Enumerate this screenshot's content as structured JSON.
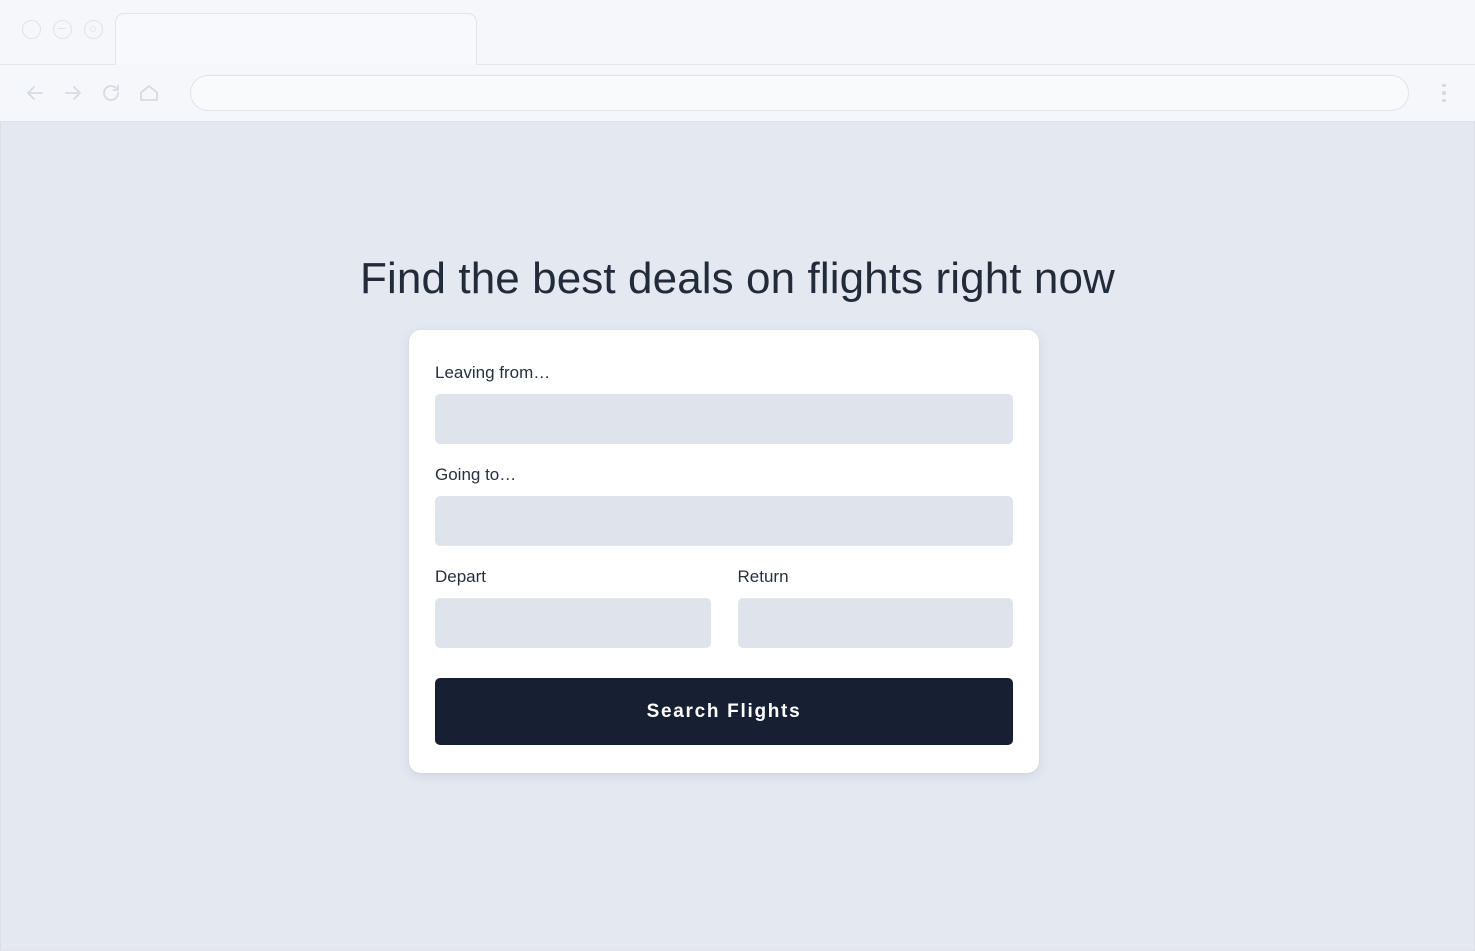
{
  "browser": {
    "window_controls": [
      {
        "name": "close",
        "icon": "circle-outline-icon"
      },
      {
        "name": "minimize",
        "icon": "circle-minus-icon"
      },
      {
        "name": "maximize",
        "icon": "circle-dot-icon"
      }
    ],
    "tab": {
      "title": ""
    },
    "toolbar": {
      "back_icon": "arrow-left-icon",
      "forward_icon": "arrow-right-icon",
      "reload_icon": "reload-icon",
      "home_icon": "home-icon",
      "menu_icon": "more-vertical-icon"
    },
    "address_bar": {
      "value": "",
      "placeholder": ""
    }
  },
  "page": {
    "heading": "Find the best deals on flights right now",
    "background_color": "#e4e8f1",
    "heading_color": "#212b3a"
  },
  "search_form": {
    "card_background": "#ffffff",
    "input_background": "#dee3ec",
    "origin": {
      "label": "Leaving from…",
      "value": "",
      "placeholder": ""
    },
    "destination": {
      "label": "Going to…",
      "value": "",
      "placeholder": ""
    },
    "depart": {
      "label": "Depart",
      "value": "",
      "placeholder": ""
    },
    "return": {
      "label": "Return",
      "value": "",
      "placeholder": ""
    },
    "submit": {
      "label": "Search Flights",
      "background_color": "#172033",
      "text_color": "#ffffff"
    }
  }
}
